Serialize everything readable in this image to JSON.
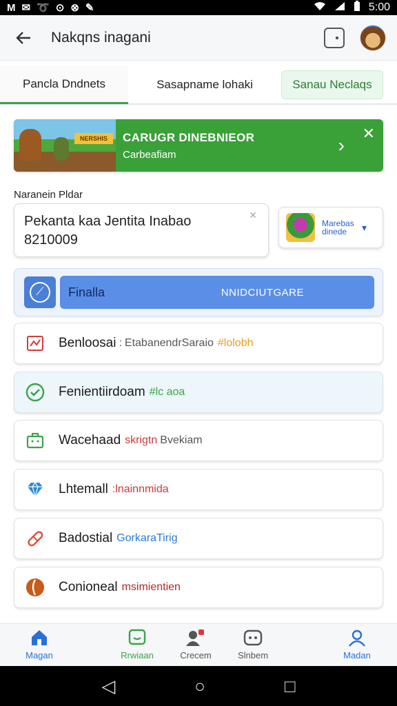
{
  "status_bar": {
    "left_glyphs": [
      "M",
      "✉",
      "➰",
      "⊙",
      "⊗",
      "✎"
    ],
    "time": "5:00"
  },
  "app_bar": {
    "title": "Nakqns inagani"
  },
  "tabs": [
    {
      "label": "Pancla Dndnets",
      "active": true
    },
    {
      "label": "Sasapname lohaki",
      "active": false
    },
    {
      "label": "Sanau Neclaqs",
      "active": false
    }
  ],
  "banner": {
    "art_tag": "NERSHIS",
    "title": "CARUGR DINEBNIEOR",
    "subtitle": "Carbeafiam"
  },
  "section_label": "Naranein Pldar",
  "input": {
    "line1": "Pekanta kaa Jentita Inabao",
    "line2": "8210009",
    "clear_label": "✕"
  },
  "game_select": {
    "label": "Marebas dinede"
  },
  "primary": {
    "label": "Finalla",
    "action": "NNIDCIUTGARE"
  },
  "list": [
    {
      "icon": "chart-icon",
      "icon_glyph": "⬚",
      "icon_color": "#d83a3a",
      "title": "Benloosai",
      "sep": ":",
      "detail": "EtabanendrSaraio",
      "tag": "#lolobh",
      "tag_color": "#e0a020",
      "highlight": false
    },
    {
      "icon": "check-circle-icon",
      "icon_glyph": "✓",
      "icon_color": "#3ca24a",
      "title": "Fenientiirdoam",
      "sep": "",
      "detail": "",
      "tag": "#lc aoa",
      "tag_color": "#3ca24a",
      "highlight": true
    },
    {
      "icon": "briefcase-icon",
      "icon_glyph": "⬚",
      "icon_color": "#3ca24a",
      "title": "Wacehaad",
      "sep": "",
      "detail": "Bvekiam",
      "tag": "skrigtn",
      "tag_color": "#c83a3a",
      "highlight": false
    },
    {
      "icon": "diamond-icon",
      "icon_glyph": "◆",
      "icon_color": "#2a8ad8",
      "title": "Lhtemall",
      "sep": "",
      "detail": "",
      "tag": ":lnainnmida",
      "tag_color": "#c83a3a",
      "highlight": false
    },
    {
      "icon": "bandage-icon",
      "icon_glyph": "⊘",
      "icon_color": "#d8503a",
      "title": "Badostial",
      "sep": "",
      "detail": "",
      "tag": "GorkaraTirig",
      "tag_color": "#2a7ad8",
      "highlight": false
    },
    {
      "icon": "shield-icon",
      "icon_glyph": "◐",
      "icon_color": "#c85a1a",
      "title": "Conioneal",
      "sep": "",
      "detail": "",
      "tag": "msimientien",
      "tag_color": "#b02a2a",
      "highlight": false
    }
  ],
  "bottom_nav": [
    {
      "label": "Magan",
      "glyph": "⌂",
      "color": "#2a6fd8"
    },
    {
      "label": "Rrwiaan",
      "glyph": "▣",
      "color": "#3ca24a"
    },
    {
      "label": "Crecem",
      "glyph": "●",
      "color": "#555555"
    },
    {
      "label": "Slnbem",
      "glyph": "⚇",
      "color": "#555555"
    },
    {
      "label": "Madan",
      "glyph": "⚲",
      "color": "#2a6fd8"
    }
  ],
  "system_nav": {
    "back": "◁",
    "home": "○",
    "recents": "□"
  }
}
